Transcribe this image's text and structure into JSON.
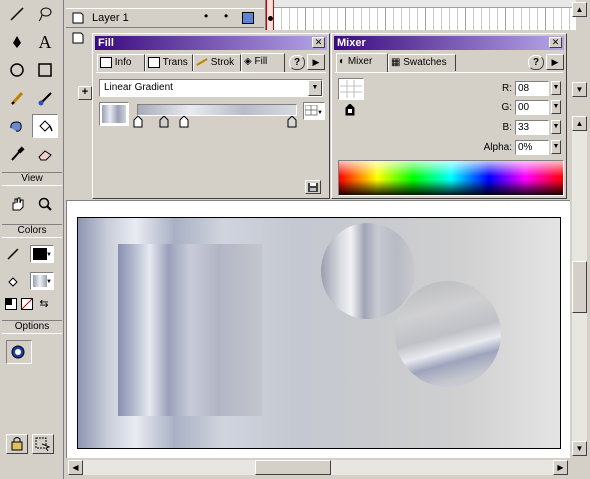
{
  "timeline": {
    "layer_name": "Layer 1"
  },
  "toolbox": {
    "sections": {
      "view": "View",
      "colors": "Colors",
      "options": "Options"
    },
    "tools": [
      "line-icon",
      "lasso-icon",
      "pen-icon",
      "text-icon",
      "oval-icon",
      "rectangle-icon",
      "pencil-icon",
      "brush-icon",
      "ink-bottle-icon",
      "paint-bucket-icon",
      "eyedropper-icon",
      "eraser-icon"
    ],
    "text_tool_glyph": "A"
  },
  "fill_panel": {
    "title": "Fill",
    "tabs": [
      "Info",
      "Trans",
      "Strok",
      "Fill"
    ],
    "active_tab": "Fill",
    "fill_type": "Linear Gradient",
    "help": "?"
  },
  "mixer_panel": {
    "title": "Mixer",
    "tabs": [
      "Mixer",
      "Swatches"
    ],
    "help": "?",
    "r_label": "R:",
    "r_value": "08",
    "g_label": "G:",
    "g_value": "00",
    "b_label": "B:",
    "b_value": "33",
    "alpha_label": "Alpha:",
    "alpha_value": "0%"
  },
  "colors": {
    "titlebar_start": "#3a0a80",
    "titlebar_end": "#b6a6e6",
    "stroke_color": "#000000"
  }
}
